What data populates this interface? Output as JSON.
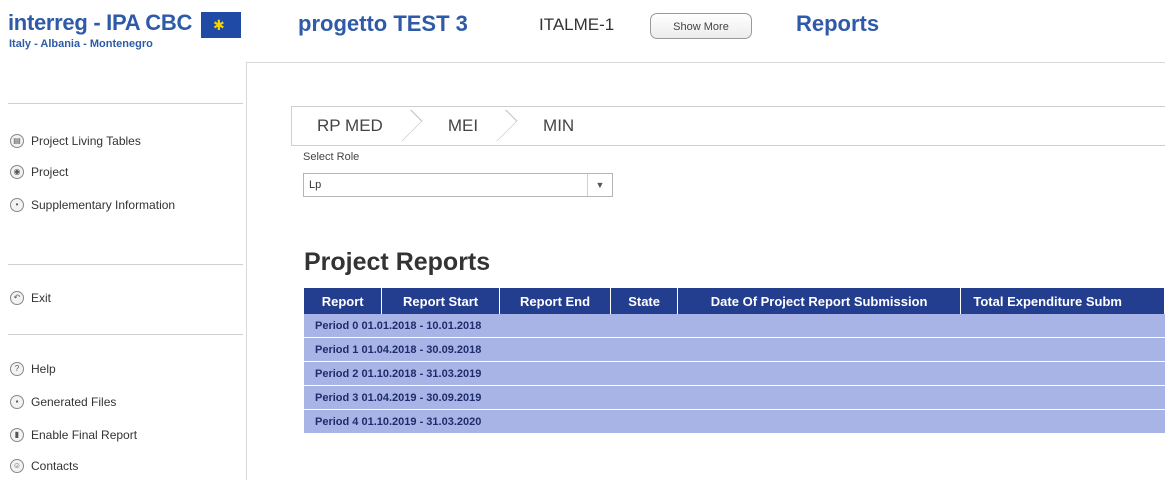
{
  "header": {
    "logo_text": "interreg - IPA CBC",
    "logo_subtext": "Italy - Albania - Montenegro",
    "project_title": "progetto TEST 3",
    "acronym": "ITALME-1",
    "show_more_label": "Show More",
    "page_title": "Reports"
  },
  "sidebar": {
    "groups": [
      [
        {
          "label": "Project Living Tables",
          "icon": "table-icon"
        },
        {
          "label": "Project",
          "icon": "project-icon"
        },
        {
          "label": "Supplementary Information",
          "icon": "info-icon"
        }
      ],
      [
        {
          "label": "Exit",
          "icon": "exit-icon"
        }
      ],
      [
        {
          "label": "Help",
          "icon": "help-icon"
        },
        {
          "label": "Generated Files",
          "icon": "files-icon"
        },
        {
          "label": "Enable Final Report",
          "icon": "report-icon"
        },
        {
          "label": "Contacts",
          "icon": "contacts-icon"
        }
      ]
    ]
  },
  "breadcrumbs": [
    "RP MED",
    "MEI",
    "MIN"
  ],
  "role": {
    "label": "Select Role",
    "selected": "Lp"
  },
  "reports": {
    "title": "Project Reports",
    "columns": [
      "Report",
      "Report Start",
      "Report End",
      "State",
      "Date Of Project Report Submission",
      "Total Expenditure Subm"
    ],
    "periods": [
      "Period 0 01.01.2018 - 10.01.2018",
      "Period 1 01.04.2018 - 30.09.2018",
      "Period 2 01.10.2018 - 31.03.2019",
      "Period 3 01.04.2019 - 30.09.2019",
      "Period 4 01.10.2019 - 31.03.2020"
    ]
  },
  "colors": {
    "brand_blue": "#2e5aa8",
    "table_header": "#233e8f",
    "table_row": "#a9b4e6"
  }
}
